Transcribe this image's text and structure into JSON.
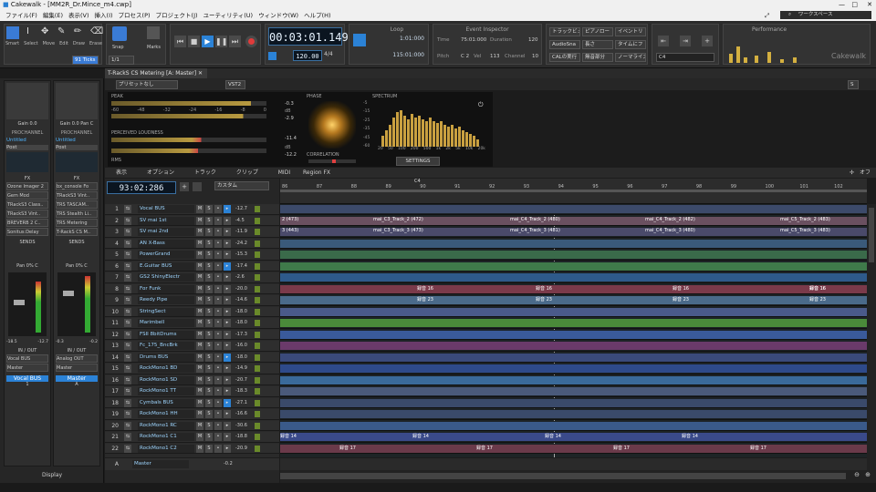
{
  "window": {
    "title": "Cakewalk - [MM2R_Dr.Mince_m4.cwp]"
  },
  "menu": [
    "ファイル(F)",
    "編集(E)",
    "表示(V)",
    "挿入(I)",
    "プロセス(P)",
    "プロジェクト(J)",
    "ユーティリティ(U)",
    "ウィンドウ(W)",
    "ヘルプ(H)"
  ],
  "search": {
    "placeholder": "ワークスペース"
  },
  "tools": {
    "labels": [
      "Smart",
      "Select",
      "Move",
      "Edit",
      "Draw",
      "Erase"
    ],
    "snap": "Snap",
    "snap_value": "1/1",
    "marks": "Marks",
    "ticks": "91 Ticks"
  },
  "transport": {
    "time": "00:03:01.149",
    "tempo": "120.00",
    "meter": "4/4"
  },
  "loop": {
    "label": "Loop",
    "start": "1:01:000",
    "end": "115:01:000"
  },
  "event_inspector": {
    "label": "Event Inspector",
    "time_label": "Time",
    "time": "75:01:000",
    "duration_label": "Duration",
    "duration": "120",
    "pitch_label": "Pitch",
    "pitch": "C 2",
    "vel_label": "Vel",
    "vel": "113",
    "channel_label": "Channel",
    "channel": "10"
  },
  "track_buttons": [
    "トラックビュー",
    "ピアノロー",
    "イベントリ",
    "AudioSna",
    "長さ",
    "タイムにフ",
    "CALの実行",
    "無音部分",
    "ノーマライズ"
  ],
  "key": "C4",
  "performance": {
    "label": "Performance",
    "brand": "Cakewalk"
  },
  "tab": {
    "label": "T-RackS CS Metering [A: Master]",
    "close": "✕"
  },
  "plugin": {
    "preset": "プリセットなし",
    "vst": "VST2",
    "s": "S",
    "peak": "PEAK",
    "peak_scale": [
      "-60",
      "-48",
      "-32",
      "-24",
      "-16",
      "-8",
      "0"
    ],
    "peak_vals": [
      "-0.3",
      "-2.9"
    ],
    "loudness": "PERCEIVED LOUDNESS",
    "loud_vals": [
      "-11.4",
      "-12.2"
    ],
    "rms": "RMS",
    "db": "dB",
    "phase": "PHASE",
    "correlation": "CORRELATION",
    "spectrum": "SPECTRUM",
    "spec_y": [
      "-5",
      "-10",
      "-15",
      "-20",
      "-25",
      "-30",
      "-35",
      "-40",
      "-45",
      "-50",
      "-55",
      "-60"
    ],
    "spec_x": [
      "20",
      "50",
      "100",
      "200",
      "500",
      "1k",
      "2k",
      "5k",
      "10k",
      "20k"
    ],
    "settings": "SETTINGS"
  },
  "inspector": {
    "gain_labels": [
      "Gain 0.0",
      "Gain 0.0",
      "Pan C"
    ],
    "prochannel": "PROCHANNEL",
    "untitled": "Untitled",
    "post": "Post",
    "fx": "FX",
    "fx_left": [
      "Ozone Imager 2",
      "Gem Mod",
      "TRackS3 Class..",
      "TRackS3 Vint..",
      "BREVERB 2 C..",
      "Sonitus:Delay"
    ],
    "fx_right": [
      "bx_console Fo",
      "TRackS3 Vint..",
      "TRS TASCAM..",
      "TRS Stealth Li..",
      "TRS Metering",
      "T-RackS CS M.."
    ],
    "sends": "SENDS",
    "pan": "Pan 0% C",
    "meter_vals": [
      "-18.5",
      "-12.7",
      "-0.3",
      "-0.2"
    ],
    "io": "IN / OUT",
    "io_left": [
      "Vocal BUS",
      "Master"
    ],
    "io_right": [
      "Analog OUT",
      "Master"
    ],
    "strip_left": "Vocal BUS",
    "strip_left_num": "1",
    "strip_right": "Master",
    "strip_right_num": "A",
    "display": "Display"
  },
  "trackview": {
    "menus": [
      "表示",
      "オプション",
      "トラック",
      "クリップ",
      "MIDI",
      "Region FX"
    ],
    "off": "オフ",
    "now": "93:02:286",
    "custom": "カスタム",
    "marker": "C4",
    "ruler": [
      "86",
      "87",
      "88",
      "89",
      "90",
      "91",
      "92",
      "93",
      "94",
      "95",
      "96",
      "97",
      "98",
      "99",
      "100",
      "101",
      "102"
    ]
  },
  "tracks": [
    {
      "n": "1",
      "name": "Vocal BUS",
      "vol": "-12.7"
    },
    {
      "n": "2",
      "name": "SV mai 1st",
      "vol": "-4.5"
    },
    {
      "n": "3",
      "name": "SV mai 2nd",
      "vol": "-11.9"
    },
    {
      "n": "4",
      "name": "AN X-Bass",
      "vol": "-24.2"
    },
    {
      "n": "5",
      "name": "PowerGrand",
      "vol": "-15.3"
    },
    {
      "n": "6",
      "name": "E.Guitar BUS",
      "vol": "-17.4"
    },
    {
      "n": "7",
      "name": "GS2 ShinyElectr",
      "vol": "-2.6"
    },
    {
      "n": "8",
      "name": "For Funk",
      "vol": "-20.0"
    },
    {
      "n": "9",
      "name": "Reedy Pipe",
      "vol": "-14.6"
    },
    {
      "n": "10",
      "name": "StringSect",
      "vol": "-18.0"
    },
    {
      "n": "11",
      "name": "Marimbell",
      "vol": "-18.0"
    },
    {
      "n": "12",
      "name": "FSII 8bitDrums",
      "vol": "-17.3"
    },
    {
      "n": "13",
      "name": "Fc_175_BncBrk",
      "vol": "-16.0"
    },
    {
      "n": "14",
      "name": "Drums BUS",
      "vol": "-18.0"
    },
    {
      "n": "15",
      "name": "RockMono1 BD",
      "vol": "-14.9"
    },
    {
      "n": "16",
      "name": "RockMono1 SD",
      "vol": "-20.7"
    },
    {
      "n": "17",
      "name": "RockMono1 TT",
      "vol": "-18.3"
    },
    {
      "n": "18",
      "name": "Cymbals BUS",
      "vol": "-27.1"
    },
    {
      "n": "19",
      "name": "RockMono1 HH",
      "vol": "-16.6"
    },
    {
      "n": "20",
      "name": "RockMono1 RC",
      "vol": "-30.6"
    },
    {
      "n": "21",
      "name": "RockMono1 C1",
      "vol": "-18.8"
    },
    {
      "n": "22",
      "name": "RockMono1 C2",
      "vol": "-20.9"
    }
  ],
  "master_row": {
    "n": "A",
    "name": "Master",
    "vol": "-0.2"
  },
  "clips": {
    "c2a": "2 (473)",
    "c2b": "mai_C3_Track_2 (472)",
    "c2c": "mai_C4_Track_2 (480)",
    "c2d": "mai_C4_Track_2 (482)",
    "c2e": "mai_C5_Track_2 (483)",
    "c3a": "3 (443)",
    "c3b": "mai_C3_Track_3 (473)",
    "c3c": "mai_C4_Track_3 (481)",
    "c3d": "mai_C4_Track_3 (480)",
    "c3e": "mai_C5_Track_3 (483)",
    "k16": "録音 16",
    "k23": "録音 23",
    "k14": "録音 14",
    "k17": "録音 17"
  },
  "colors": {
    "accent": "#4fb4ff",
    "time_bg": "#0b1520"
  }
}
